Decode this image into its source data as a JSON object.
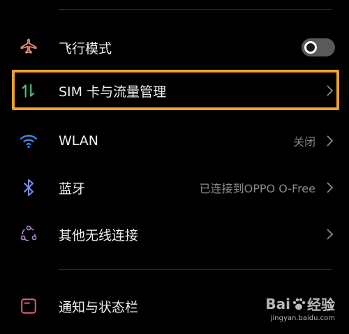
{
  "rows": [
    {
      "label": "飞行模式",
      "icon": "airplane-icon"
    },
    {
      "label": "SIM 卡与流量管理",
      "icon": "sim-data-icon"
    },
    {
      "label": "WLAN",
      "value": "关闭",
      "icon": "wifi-icon"
    },
    {
      "label": "蓝牙",
      "value": "已连接到OPPO O-Free",
      "icon": "bluetooth-icon"
    },
    {
      "label": "其他无线连接",
      "icon": "wireless-connections-icon"
    },
    {
      "label": "通知与状态栏",
      "icon": "notification-icon"
    }
  ],
  "airplane_toggle": {
    "state": "off"
  },
  "watermark": {
    "brand_left": "Bai",
    "brand_right": "经验",
    "url": "jingyan.baidu.com"
  },
  "colors": {
    "background": "#000000",
    "highlight": "#f1a22a",
    "airplane_icon": "#e88a6a",
    "sim_icon": "#4fc07a",
    "wifi_icon": "#3f8fe8",
    "bluetooth_icon": "#7a8ef0",
    "wireless_icon": "#b58ae0",
    "notification_icon": "#e8607a"
  }
}
